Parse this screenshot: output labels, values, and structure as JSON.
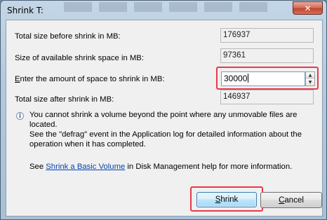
{
  "window": {
    "title": "Shrink T:",
    "close_glyph": "✕"
  },
  "rows": {
    "total_size_label": "Total size before shrink in MB:",
    "total_size_value": "176937",
    "available_label": "Size of available shrink space in MB:",
    "available_value": "97361",
    "amount_label_pre": "E",
    "amount_label_rest": "nter the amount of space to shrink in MB:",
    "amount_value": "30000",
    "after_label": "Total size after shrink in MB:",
    "after_value": "146937"
  },
  "info": {
    "icon": "info-icon",
    "icon_glyph": "i",
    "line1": "You cannot shrink a volume beyond the point where any unmovable files are located.",
    "line2": "See the \"defrag\" event in the Application log for detailed information about the",
    "line3": "operation when it has completed."
  },
  "help": {
    "pre": "See ",
    "link": "Shrink a Basic Volume",
    "post": " in Disk Management help for more information."
  },
  "buttons": {
    "shrink_accel": "S",
    "shrink_rest": "hrink",
    "cancel_accel": "C",
    "cancel_rest": "ancel"
  },
  "spin": {
    "up": "▲",
    "down": "▼"
  },
  "colors": {
    "highlight": "#e8394a",
    "link": "#0645ad",
    "close_button": "#c2452d"
  }
}
